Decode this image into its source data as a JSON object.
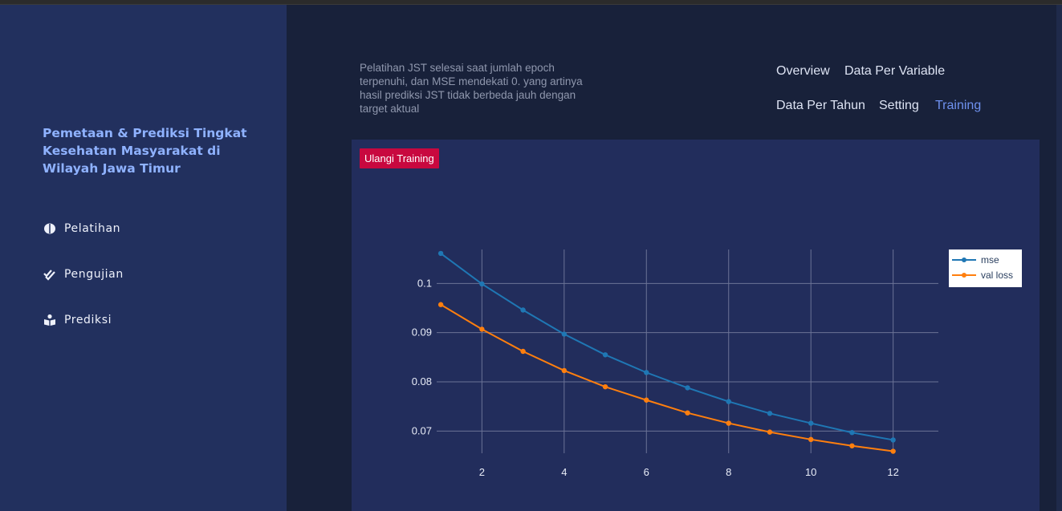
{
  "sidebar": {
    "brand": "Pemetaan & Prediksi Tingkat Kesehatan Masyarakat di Wilayah Jawa Timur",
    "items": [
      {
        "label": "Pelatihan",
        "icon": "brain-icon"
      },
      {
        "label": "Pengujian",
        "icon": "check-double-icon"
      },
      {
        "label": "Prediksi",
        "icon": "book-reader-icon"
      }
    ]
  },
  "header": {
    "description": "Pelatihan JST selesai saat jumlah epoch terpenuhi, dan MSE mendekati 0. yang artinya hasil prediksi JST tidak berbeda jauh dengan target aktual",
    "nav": [
      "Overview",
      "Data Per Variable",
      "Data Per Tahun",
      "Setting",
      "Training"
    ],
    "active_nav": "Training"
  },
  "main": {
    "retrain_label": "Ulangi Training"
  },
  "colors": {
    "sidebar_bg": "#22305e",
    "page_bg": "#18213a",
    "panel_bg": "#222d5c",
    "brand_text": "#8fb2ff",
    "active_nav": "#6f92f0",
    "button_bg": "#c8083f",
    "mse_line": "#1f77b4",
    "val_loss_line": "#ff7f0e"
  },
  "chart_data": {
    "type": "line",
    "x": [
      1,
      2,
      3,
      4,
      5,
      6,
      7,
      8,
      9,
      10,
      11,
      12
    ],
    "series": [
      {
        "name": "mse",
        "values": [
          0.1061,
          0.0999,
          0.0946,
          0.0897,
          0.0855,
          0.0819,
          0.0788,
          0.076,
          0.0736,
          0.0716,
          0.0697,
          0.0682
        ]
      },
      {
        "name": "val loss",
        "values": [
          0.0957,
          0.0907,
          0.0862,
          0.0823,
          0.079,
          0.0763,
          0.0737,
          0.0716,
          0.0698,
          0.0683,
          0.067,
          0.0659
        ]
      }
    ],
    "xlim": [
      0.9,
      13.1
    ],
    "ylim": [
      0.0655,
      0.1069
    ],
    "x_ticks": [
      2,
      4,
      6,
      8,
      10,
      12
    ],
    "y_ticks": [
      0.07,
      0.08,
      0.09,
      0.1
    ],
    "y_tick_labels": [
      "0.07",
      "0.08",
      "0.09",
      "0.1"
    ],
    "grid": true,
    "legend": "top-right",
    "title": "",
    "xlabel": "",
    "ylabel": ""
  }
}
